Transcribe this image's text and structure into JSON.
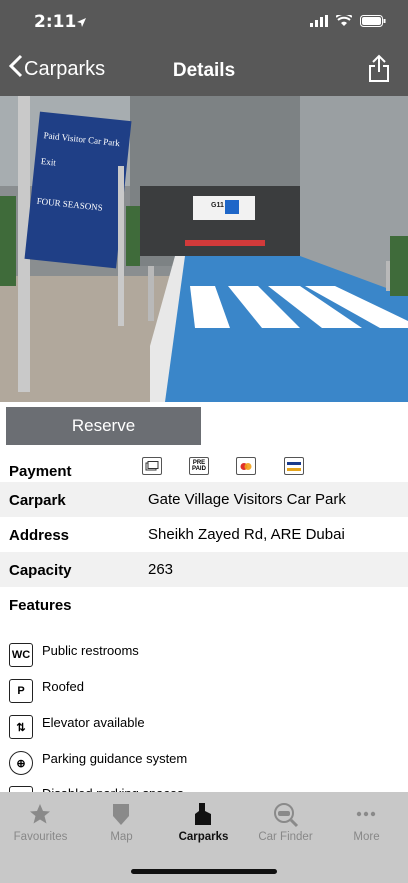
{
  "status": {
    "time": "2:11"
  },
  "nav": {
    "back_label": "Carparks",
    "title": "Details"
  },
  "photo": {
    "sign_lines": [
      "Paid Visitor Car Park",
      "Exit",
      "FOUR SEASONS"
    ],
    "gate_code": "G11"
  },
  "reserve_label": "Reserve",
  "payment": {
    "label": "Payment",
    "methods": [
      "card-icon",
      "PRE PAID",
      "mastercard-icon",
      "visa-icon"
    ],
    "prepaid_line1": "PRE",
    "prepaid_line2": "PAID"
  },
  "details": [
    {
      "label": "Carpark",
      "value": "Gate Village Visitors Car Park"
    },
    {
      "label": "Address",
      "value": "Sheikh Zayed Rd, ARE Dubai"
    },
    {
      "label": "Capacity",
      "value": "263"
    }
  ],
  "features_title": "Features",
  "features": [
    {
      "icon": "wc-icon",
      "icon_text": "WC",
      "label": "Public restrooms"
    },
    {
      "icon": "roofed-icon",
      "icon_text": "P",
      "label": "Roofed"
    },
    {
      "icon": "elevator-icon",
      "icon_text": "⇅",
      "label": "Elevator available"
    },
    {
      "icon": "guidance-icon",
      "icon_text": "⊕",
      "label": "Parking guidance system"
    },
    {
      "icon": "disabled-icon",
      "icon_text": "♿",
      "label": "Disabled parking spaces"
    }
  ],
  "tabs": [
    {
      "label": "Favourites",
      "icon": "star-icon"
    },
    {
      "label": "Map",
      "icon": "map-pin-icon"
    },
    {
      "label": "Carparks",
      "icon": "carpark-icon",
      "active": true
    },
    {
      "label": "Car Finder",
      "icon": "car-finder-icon"
    },
    {
      "label": "More",
      "icon": "more-icon"
    }
  ],
  "colors": {
    "nav_bg": "#585858",
    "tab_bg": "#c8c8c8",
    "button_bg": "#6b6e73",
    "row_alt": "#f1f1f1"
  }
}
